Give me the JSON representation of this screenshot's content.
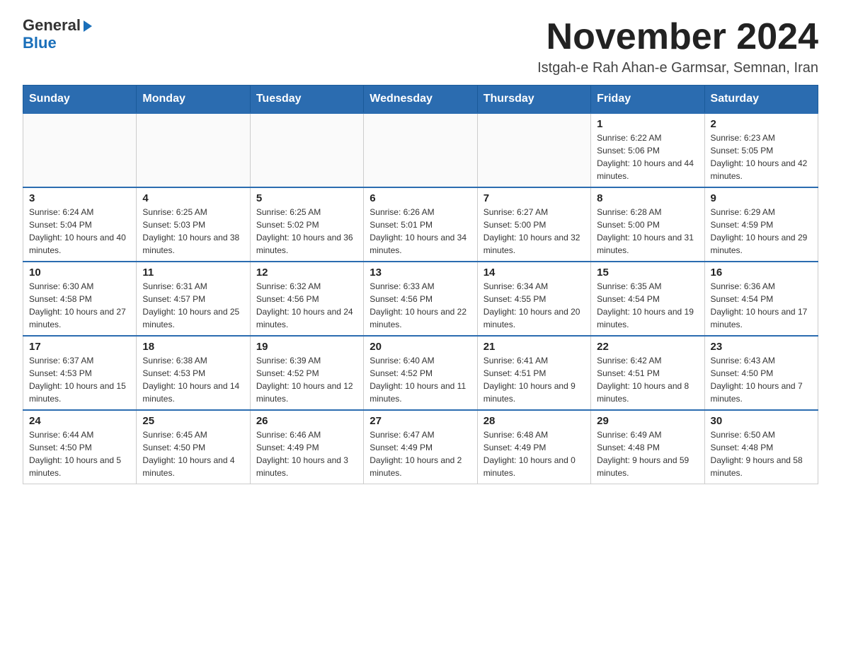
{
  "logo": {
    "line1": "General",
    "line2": "Blue",
    "arrow_char": "▶"
  },
  "title": "November 2024",
  "location": "Istgah-e Rah Ahan-e Garmsar, Semnan, Iran",
  "days_of_week": [
    "Sunday",
    "Monday",
    "Tuesday",
    "Wednesday",
    "Thursday",
    "Friday",
    "Saturday"
  ],
  "weeks": [
    [
      {
        "day": "",
        "info": ""
      },
      {
        "day": "",
        "info": ""
      },
      {
        "day": "",
        "info": ""
      },
      {
        "day": "",
        "info": ""
      },
      {
        "day": "",
        "info": ""
      },
      {
        "day": "1",
        "info": "Sunrise: 6:22 AM\nSunset: 5:06 PM\nDaylight: 10 hours and 44 minutes."
      },
      {
        "day": "2",
        "info": "Sunrise: 6:23 AM\nSunset: 5:05 PM\nDaylight: 10 hours and 42 minutes."
      }
    ],
    [
      {
        "day": "3",
        "info": "Sunrise: 6:24 AM\nSunset: 5:04 PM\nDaylight: 10 hours and 40 minutes."
      },
      {
        "day": "4",
        "info": "Sunrise: 6:25 AM\nSunset: 5:03 PM\nDaylight: 10 hours and 38 minutes."
      },
      {
        "day": "5",
        "info": "Sunrise: 6:25 AM\nSunset: 5:02 PM\nDaylight: 10 hours and 36 minutes."
      },
      {
        "day": "6",
        "info": "Sunrise: 6:26 AM\nSunset: 5:01 PM\nDaylight: 10 hours and 34 minutes."
      },
      {
        "day": "7",
        "info": "Sunrise: 6:27 AM\nSunset: 5:00 PM\nDaylight: 10 hours and 32 minutes."
      },
      {
        "day": "8",
        "info": "Sunrise: 6:28 AM\nSunset: 5:00 PM\nDaylight: 10 hours and 31 minutes."
      },
      {
        "day": "9",
        "info": "Sunrise: 6:29 AM\nSunset: 4:59 PM\nDaylight: 10 hours and 29 minutes."
      }
    ],
    [
      {
        "day": "10",
        "info": "Sunrise: 6:30 AM\nSunset: 4:58 PM\nDaylight: 10 hours and 27 minutes."
      },
      {
        "day": "11",
        "info": "Sunrise: 6:31 AM\nSunset: 4:57 PM\nDaylight: 10 hours and 25 minutes."
      },
      {
        "day": "12",
        "info": "Sunrise: 6:32 AM\nSunset: 4:56 PM\nDaylight: 10 hours and 24 minutes."
      },
      {
        "day": "13",
        "info": "Sunrise: 6:33 AM\nSunset: 4:56 PM\nDaylight: 10 hours and 22 minutes."
      },
      {
        "day": "14",
        "info": "Sunrise: 6:34 AM\nSunset: 4:55 PM\nDaylight: 10 hours and 20 minutes."
      },
      {
        "day": "15",
        "info": "Sunrise: 6:35 AM\nSunset: 4:54 PM\nDaylight: 10 hours and 19 minutes."
      },
      {
        "day": "16",
        "info": "Sunrise: 6:36 AM\nSunset: 4:54 PM\nDaylight: 10 hours and 17 minutes."
      }
    ],
    [
      {
        "day": "17",
        "info": "Sunrise: 6:37 AM\nSunset: 4:53 PM\nDaylight: 10 hours and 15 minutes."
      },
      {
        "day": "18",
        "info": "Sunrise: 6:38 AM\nSunset: 4:53 PM\nDaylight: 10 hours and 14 minutes."
      },
      {
        "day": "19",
        "info": "Sunrise: 6:39 AM\nSunset: 4:52 PM\nDaylight: 10 hours and 12 minutes."
      },
      {
        "day": "20",
        "info": "Sunrise: 6:40 AM\nSunset: 4:52 PM\nDaylight: 10 hours and 11 minutes."
      },
      {
        "day": "21",
        "info": "Sunrise: 6:41 AM\nSunset: 4:51 PM\nDaylight: 10 hours and 9 minutes."
      },
      {
        "day": "22",
        "info": "Sunrise: 6:42 AM\nSunset: 4:51 PM\nDaylight: 10 hours and 8 minutes."
      },
      {
        "day": "23",
        "info": "Sunrise: 6:43 AM\nSunset: 4:50 PM\nDaylight: 10 hours and 7 minutes."
      }
    ],
    [
      {
        "day": "24",
        "info": "Sunrise: 6:44 AM\nSunset: 4:50 PM\nDaylight: 10 hours and 5 minutes."
      },
      {
        "day": "25",
        "info": "Sunrise: 6:45 AM\nSunset: 4:50 PM\nDaylight: 10 hours and 4 minutes."
      },
      {
        "day": "26",
        "info": "Sunrise: 6:46 AM\nSunset: 4:49 PM\nDaylight: 10 hours and 3 minutes."
      },
      {
        "day": "27",
        "info": "Sunrise: 6:47 AM\nSunset: 4:49 PM\nDaylight: 10 hours and 2 minutes."
      },
      {
        "day": "28",
        "info": "Sunrise: 6:48 AM\nSunset: 4:49 PM\nDaylight: 10 hours and 0 minutes."
      },
      {
        "day": "29",
        "info": "Sunrise: 6:49 AM\nSunset: 4:48 PM\nDaylight: 9 hours and 59 minutes."
      },
      {
        "day": "30",
        "info": "Sunrise: 6:50 AM\nSunset: 4:48 PM\nDaylight: 9 hours and 58 minutes."
      }
    ]
  ]
}
